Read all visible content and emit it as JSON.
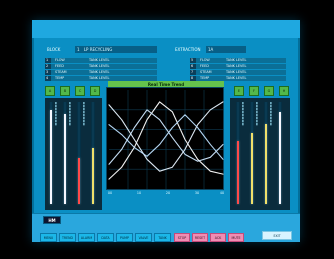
{
  "header": {
    "left_block_label": "BLOCK",
    "left_block_value": "1",
    "left_block_desc": "LP RECYCLING",
    "right_block_label": "EXTRACTION",
    "right_block_value": "1A"
  },
  "left_table": {
    "rows": [
      {
        "tag": "1",
        "name": "FLOW",
        "desc": "TANK LEVEL"
      },
      {
        "tag": "2",
        "name": "FEED",
        "desc": "TANK LEVEL"
      },
      {
        "tag": "3",
        "name": "STEAM",
        "desc": "TANK LEVEL"
      },
      {
        "tag": "4",
        "name": "TEMP",
        "desc": "TANK LEVEL"
      }
    ]
  },
  "right_table": {
    "rows": [
      {
        "tag": "5",
        "name": "FLOW",
        "desc": "TANK LEVEL"
      },
      {
        "tag": "6",
        "name": "FEED",
        "desc": "TANK LEVEL"
      },
      {
        "tag": "7",
        "name": "STEAM",
        "desc": "TANK LEVEL"
      },
      {
        "tag": "8",
        "name": "TEMP",
        "desc": "TANK LEVEL"
      }
    ]
  },
  "left_controls": {
    "buttons": [
      "A",
      "B",
      "C",
      "D"
    ],
    "gauges": [
      {
        "fill": 0.92,
        "color": "#f5f7ff"
      },
      {
        "fill": 0.88,
        "color": "#f5f7ff"
      },
      {
        "fill": 0.45,
        "color": "#ff4a4a"
      },
      {
        "fill": 0.55,
        "color": "#f0e06a"
      }
    ]
  },
  "right_controls": {
    "buttons": [
      "E",
      "F",
      "G",
      "H"
    ],
    "gauges": [
      {
        "fill": 0.62,
        "color": "#ff4a4a"
      },
      {
        "fill": 0.7,
        "color": "#f0e06a"
      },
      {
        "fill": 0.78,
        "color": "#f0e06a"
      },
      {
        "fill": 0.9,
        "color": "#f5f7ff"
      }
    ]
  },
  "trend": {
    "title": "Real Time Trend",
    "x_labels": [
      "00",
      "10",
      "20",
      "30",
      "40"
    ],
    "series": [
      {
        "color": "#ffffff",
        "values": [
          0.1,
          0.22,
          0.42,
          0.7,
          0.88,
          0.78,
          0.5,
          0.3,
          0.18,
          0.15
        ]
      },
      {
        "color": "#e7f3ff",
        "values": [
          0.85,
          0.7,
          0.5,
          0.3,
          0.18,
          0.22,
          0.4,
          0.65,
          0.8,
          0.88
        ]
      },
      {
        "color": "#cfe8ff",
        "values": [
          0.25,
          0.4,
          0.62,
          0.8,
          0.7,
          0.52,
          0.35,
          0.28,
          0.32,
          0.45
        ]
      },
      {
        "color": "#bde0ff",
        "values": [
          0.65,
          0.55,
          0.42,
          0.33,
          0.45,
          0.62,
          0.75,
          0.62,
          0.45,
          0.3
        ]
      }
    ]
  },
  "bottom": {
    "logo_text": "HM",
    "buttons": [
      {
        "label": "MENU",
        "style": "cyan"
      },
      {
        "label": "TREND",
        "style": "cyan"
      },
      {
        "label": "ALARM",
        "style": "cyan"
      },
      {
        "label": "DATA",
        "style": "cyan"
      },
      {
        "label": "PUMP",
        "style": "cyan"
      },
      {
        "label": "VALVE",
        "style": "cyan"
      },
      {
        "label": "TANK",
        "style": "cyan"
      },
      {
        "label": "STOP",
        "style": "pink"
      },
      {
        "label": "RESET",
        "style": "pink"
      },
      {
        "label": "ACK",
        "style": "pink"
      },
      {
        "label": "MUTE",
        "style": "pink"
      },
      {
        "label": "EXIT",
        "style": "white"
      }
    ]
  }
}
